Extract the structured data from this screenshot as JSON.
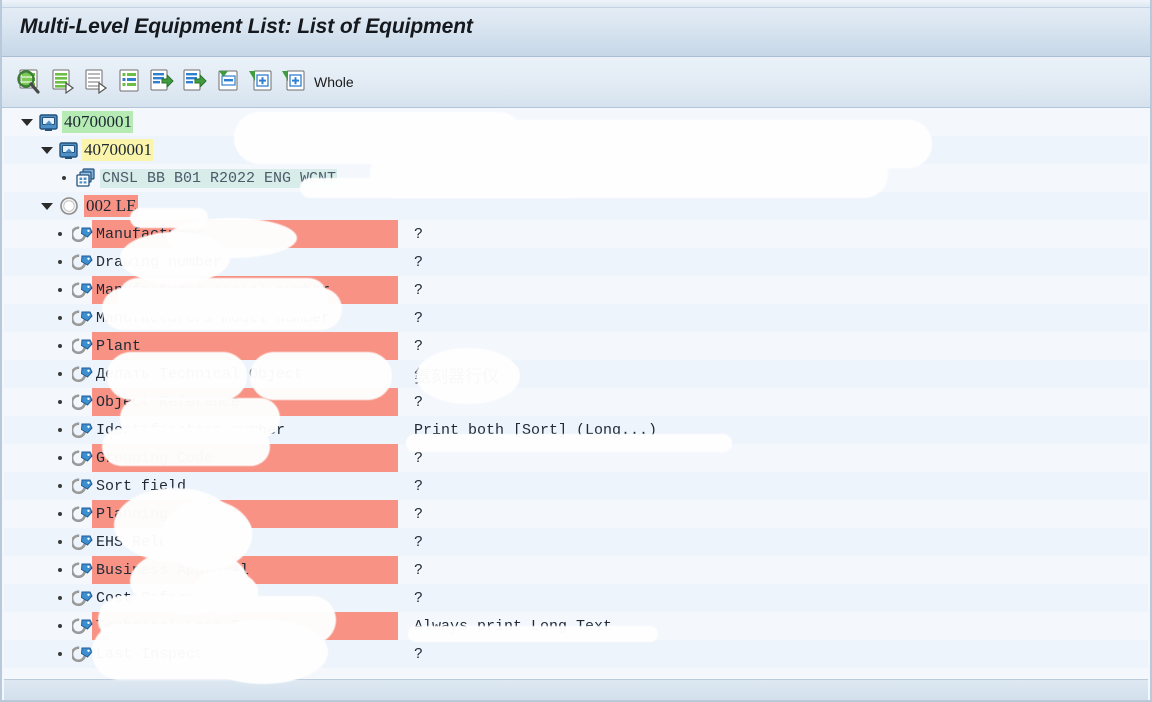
{
  "window": {
    "title": "Multi-Level Equipment List: List of Equipment"
  },
  "toolbar": {
    "buttons": [
      {
        "name": "find-icon",
        "label": "Find"
      },
      {
        "name": "expand-subtree-icon",
        "label": "Expand Subtree"
      },
      {
        "name": "collapse-subtree-icon",
        "label": "Collapse Subtree"
      },
      {
        "name": "detail-list-icon",
        "label": "Detail List"
      },
      {
        "name": "export-list-icon",
        "label": "Export List"
      },
      {
        "name": "export-list-2-icon",
        "label": "Export List 2"
      },
      {
        "name": "collapse-all-icon",
        "label": "Collapse All"
      },
      {
        "name": "expand-one-level-icon",
        "label": "Expand One Level"
      },
      {
        "name": "expand-whole-icon",
        "label": "Expand Whole"
      }
    ],
    "whole_label": "Whole"
  },
  "tree": {
    "nodes": [
      {
        "label": "40700001",
        "highlight": "green",
        "icon": "equipment-icon",
        "indent": 14,
        "expander": "open",
        "redacted_tail": true
      },
      {
        "label": "40700001",
        "highlight": "yellow",
        "icon": "equipment-icon",
        "indent": 34,
        "expander": "open",
        "redacted_tail": true
      },
      {
        "label": "CNSL BB B01 R2022 ENG WCNT",
        "highlight": "teal",
        "icon": "multi-object-icon",
        "indent": 52,
        "expander": "bullet",
        "redacted_tail": true
      },
      {
        "label": "002 LE",
        "highlight": "salmon",
        "icon": "circle-node-icon",
        "indent": 34,
        "expander": "open",
        "redacted_tail": true
      }
    ]
  },
  "attributes": {
    "value_unknown": "?",
    "rows": [
      {
        "name": "Manufacturer",
        "value": "?"
      },
      {
        "name": "Drawing number",
        "value": "?"
      },
      {
        "name": "Manufacturer serial number",
        "value": "?"
      },
      {
        "name": "Manufacturers model number",
        "value": "?"
      },
      {
        "name": "Plant",
        "value": "?"
      },
      {
        "name": "Делать Technical Object",
        "value": "氨刻器行仪"
      },
      {
        "name": "Object Reference",
        "value": "?"
      },
      {
        "name": "Identification number",
        "value": "Print both  [Sort] (Long...)"
      },
      {
        "name": "Grouping Code",
        "value": "?"
      },
      {
        "name": "Sort field",
        "value": "?"
      },
      {
        "name": "Planning descrit",
        "value": "?"
      },
      {
        "name": "EHS Relevant",
        "value": "?"
      },
      {
        "name": "Business Approval",
        "value": "?"
      },
      {
        "name": "Cost Reference",
        "value": "?"
      },
      {
        "name": "Technical Long Text",
        "value": "Always print Long Text"
      },
      {
        "name": "Last Inspection Date",
        "value": "?"
      }
    ]
  }
}
